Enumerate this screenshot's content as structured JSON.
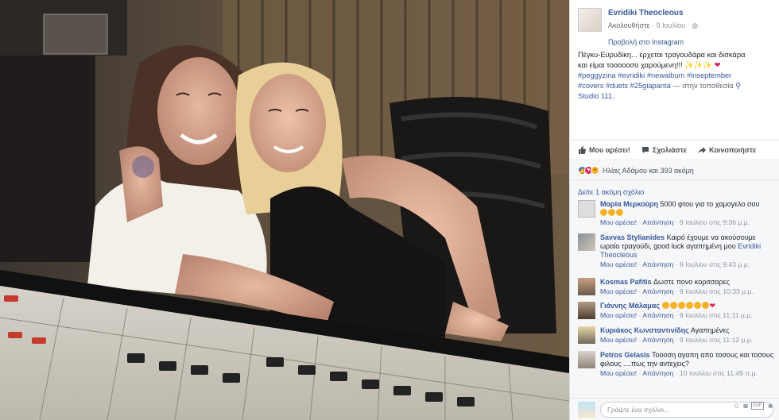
{
  "post": {
    "author": "Evridiki Theocleous",
    "follow": "Ακολουθήστε",
    "date": "9 Ιουλίου",
    "instagram": "Προβολή στο Instagram",
    "text_line1": "Πέγκυ-Ευρυδίκη... έρχεται τραγουδάρα και δισκάρα",
    "text_line2": "και είμαι τοοοοοσο χαρούμενη!!!",
    "hashtags1": "#peggyzina #evridiki #newalbum #inseptember",
    "hashtags2": "#covers #duets #25giapanta",
    "location_prefix": "— στην τοποθεσία",
    "location": "Studio 111",
    "location_suffix": "."
  },
  "actions": {
    "like": "Μου αρέσει!",
    "comment": "Σχολιάστε",
    "share": "Κοινοποιήστε"
  },
  "reactions": {
    "text": "Ηλίας Αδάμου και 393 ακόμη"
  },
  "comments": {
    "more": "Δείτε 1 ακόμη σχόλιο",
    "like_label": "Μου αρέσει!",
    "reply_label": "Απάντηση",
    "items": [
      {
        "name": "Μαρία Μερκούρη",
        "text": "5000 φτου για το χαμογελο σου",
        "time": "9 Ιουλίου στις 9:36 μ.μ."
      },
      {
        "name": "Savvas Stylianides",
        "text": "Καιρό έχουμε να ακούσουμε ωραίο τραγούδι, good luck αγαπημένη μου",
        "mention": "Evridiki Theocleous",
        "time": "9 Ιουλίου στις 9:43 μ.μ."
      },
      {
        "name": "Kosmas Pafitis",
        "text": "Δωστε πονο κοριτσαρες",
        "time": "9 Ιουλίου στις 10:33 μ.μ."
      },
      {
        "name": "Γιάννης Μάλαμας",
        "text": "",
        "time": "9 Ιουλίου στις 11:11 μ.μ."
      },
      {
        "name": "Κυριάκος Κωνσταντινίδης",
        "text": "Αγαπημένες",
        "time": "9 Ιουλίου στις 11:12 μ.μ."
      },
      {
        "name": "Petros Gelasis",
        "text": "Τοοοση αγαπη απο τοσους και τοσους φιλους ....πως την αντεχεις?",
        "time": "10 Ιουλίου στις 11:49 π.μ."
      }
    ]
  },
  "composer": {
    "placeholder": "Γράψτε ένα σχόλιο..."
  },
  "colors": {
    "link": "#365899",
    "background": "#f6f7f9",
    "heart": "#e0245e"
  }
}
